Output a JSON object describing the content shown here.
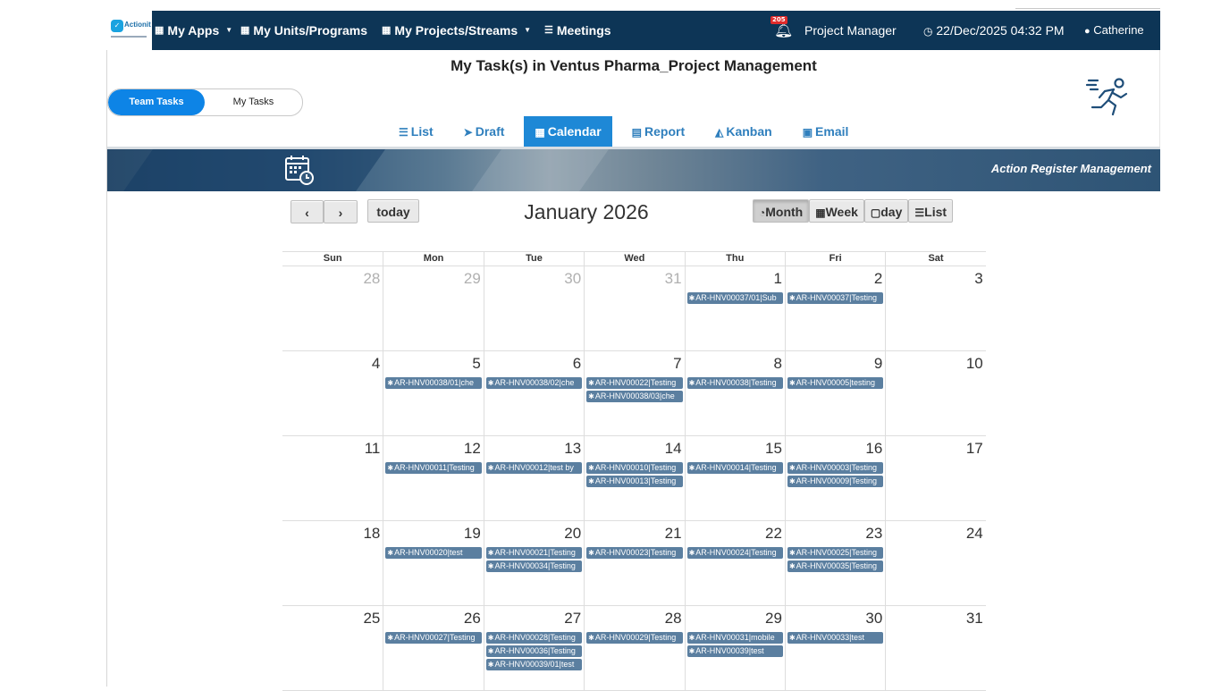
{
  "nav": {
    "my_apps": "My Apps",
    "my_units": "My Units/Programs",
    "my_projects": "My Projects/Streams",
    "meetings": "Meetings",
    "notification_count": "205",
    "role": "Project Manager",
    "datetime": "22/Dec/2025 04:32 PM",
    "user": "Catherine"
  },
  "logo": {
    "brand": "Actionit"
  },
  "page": {
    "title": "My Task(s) in Ventus Pharma_Project Management",
    "toggle_team": "Team Tasks",
    "toggle_my": "My Tasks"
  },
  "tabs": [
    {
      "label": "List",
      "icon": "list-icon"
    },
    {
      "label": "Draft",
      "icon": "paper-plane-icon"
    },
    {
      "label": "Calendar",
      "icon": "calendar-icon",
      "active": true
    },
    {
      "label": "Report",
      "icon": "book-icon"
    },
    {
      "label": "Kanban",
      "icon": "area-chart-icon"
    },
    {
      "label": "Email",
      "icon": "save-icon"
    }
  ],
  "banner": {
    "title": "Action Register Management"
  },
  "calendar": {
    "title": "January 2026",
    "today_label": "today",
    "prev": "‹",
    "next": "›",
    "views": [
      {
        "label": "Month",
        "active": true
      },
      {
        "label": "Week"
      },
      {
        "label": "day"
      },
      {
        "label": "List"
      }
    ],
    "day_names": [
      "Sun",
      "Mon",
      "Tue",
      "Wed",
      "Thu",
      "Fri",
      "Sat"
    ],
    "weeks": [
      [
        {
          "n": "28",
          "other": true,
          "events": []
        },
        {
          "n": "29",
          "other": true,
          "events": []
        },
        {
          "n": "30",
          "other": true,
          "events": []
        },
        {
          "n": "31",
          "other": true,
          "events": []
        },
        {
          "n": "1",
          "events": [
            "AR-HNV00037/01|Sub"
          ]
        },
        {
          "n": "2",
          "events": [
            "AR-HNV00037|Testing"
          ]
        },
        {
          "n": "3",
          "events": []
        }
      ],
      [
        {
          "n": "4",
          "events": []
        },
        {
          "n": "5",
          "events": [
            "AR-HNV00038/01|che"
          ]
        },
        {
          "n": "6",
          "events": [
            "AR-HNV00038/02|che"
          ]
        },
        {
          "n": "7",
          "events": [
            "AR-HNV00022|Testing",
            "AR-HNV00038/03|che"
          ]
        },
        {
          "n": "8",
          "events": [
            "AR-HNV00038|Testing"
          ]
        },
        {
          "n": "9",
          "events": [
            "AR-HNV00005|testing"
          ]
        },
        {
          "n": "10",
          "events": []
        }
      ],
      [
        {
          "n": "11",
          "events": []
        },
        {
          "n": "12",
          "events": [
            "AR-HNV00011|Testing"
          ]
        },
        {
          "n": "13",
          "events": [
            "AR-HNV00012|test by"
          ]
        },
        {
          "n": "14",
          "events": [
            "AR-HNV00010|Testing",
            "AR-HNV00013|Testing"
          ]
        },
        {
          "n": "15",
          "events": [
            "AR-HNV00014|Testing"
          ]
        },
        {
          "n": "16",
          "events": [
            "AR-HNV00003|Testing",
            "AR-HNV00009|Testing"
          ]
        },
        {
          "n": "17",
          "events": []
        }
      ],
      [
        {
          "n": "18",
          "events": []
        },
        {
          "n": "19",
          "events": [
            "AR-HNV00020|test"
          ]
        },
        {
          "n": "20",
          "events": [
            "AR-HNV00021|Testing",
            "AR-HNV00034|Testing"
          ]
        },
        {
          "n": "21",
          "events": [
            "AR-HNV00023|Testing"
          ]
        },
        {
          "n": "22",
          "events": [
            "AR-HNV00024|Testing"
          ]
        },
        {
          "n": "23",
          "events": [
            "AR-HNV00025|Testing",
            "AR-HNV00035|Testing"
          ]
        },
        {
          "n": "24",
          "events": []
        }
      ],
      [
        {
          "n": "25",
          "events": []
        },
        {
          "n": "26",
          "events": [
            "AR-HNV00027|Testing"
          ]
        },
        {
          "n": "27",
          "events": [
            "AR-HNV00028|Testing",
            "AR-HNV00036|Testing",
            "AR-HNV00039/01|test"
          ]
        },
        {
          "n": "28",
          "events": [
            "AR-HNV00029|Testing"
          ]
        },
        {
          "n": "29",
          "events": [
            "AR-HNV00031|mobile",
            "AR-HNV00039|test"
          ]
        },
        {
          "n": "30",
          "events": [
            "AR-HNV00033|test"
          ]
        },
        {
          "n": "31",
          "events": []
        }
      ]
    ]
  },
  "colors": {
    "navbar": "#0d3556",
    "tab_active": "#1e88d6",
    "tab_text": "#2f7fbd",
    "toggle_active": "#0d84e6",
    "event": "#5b7fa0",
    "badge": "#e02b2b"
  }
}
